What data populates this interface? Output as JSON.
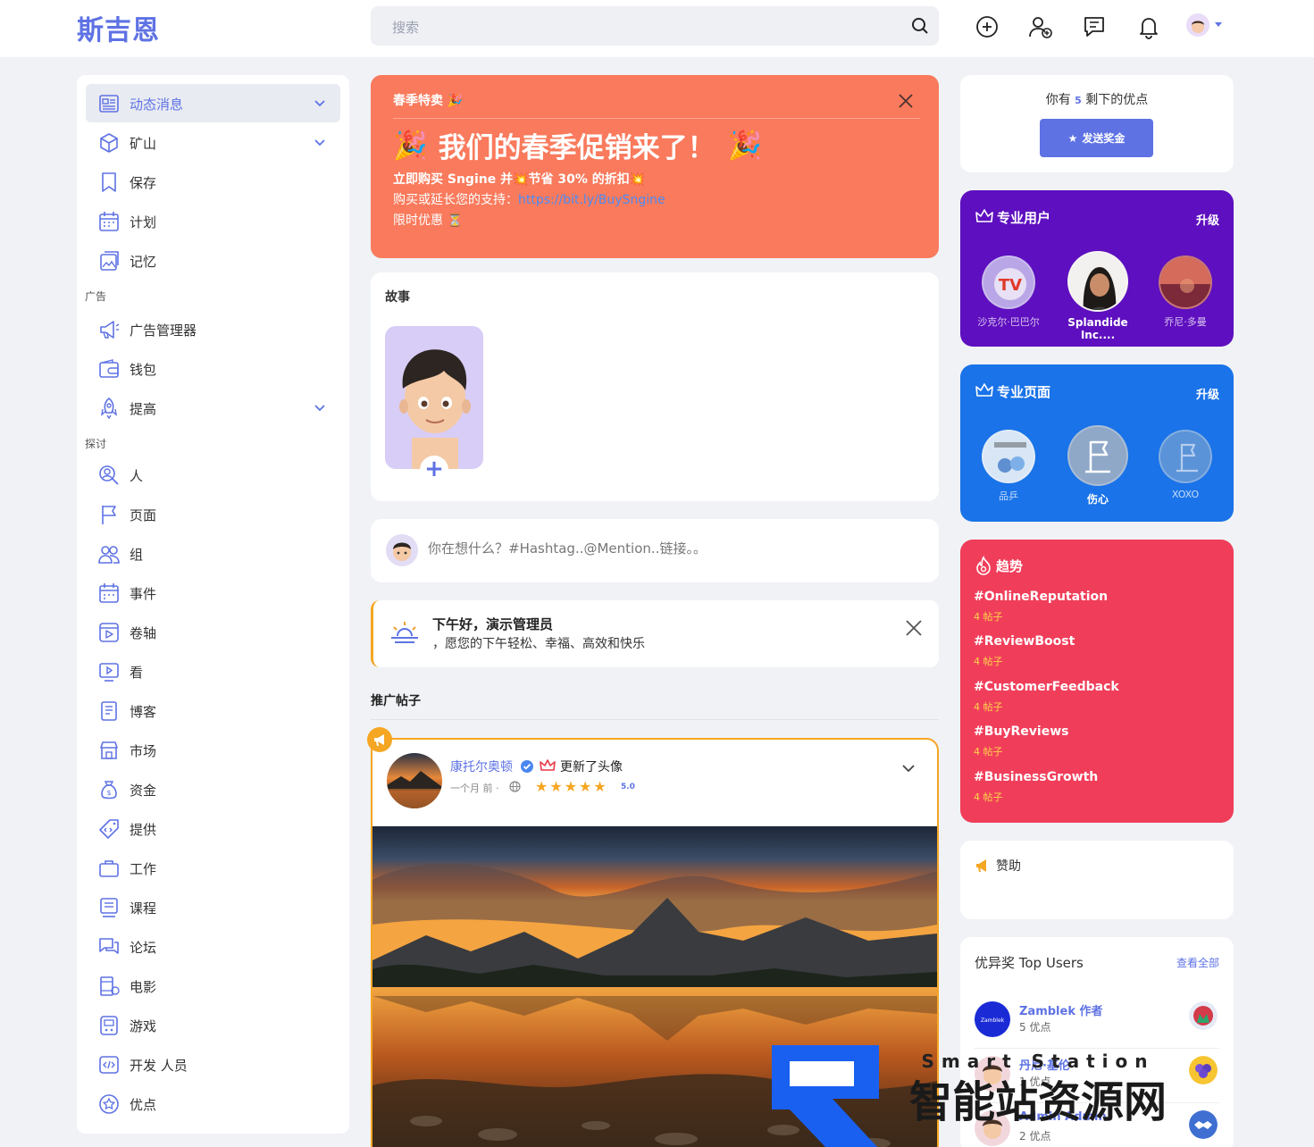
{
  "app": {
    "logo": "斯吉恩"
  },
  "search": {
    "placeholder": "搜索"
  },
  "sidebar": {
    "items": [
      {
        "label": "动态消息"
      },
      {
        "label": "矿山"
      },
      {
        "label": "保存"
      },
      {
        "label": "计划"
      },
      {
        "label": "记忆"
      },
      {
        "label": "广告管理器"
      },
      {
        "label": "钱包"
      },
      {
        "label": "提高"
      },
      {
        "label": "人"
      },
      {
        "label": "页面"
      },
      {
        "label": "组"
      },
      {
        "label": "事件"
      },
      {
        "label": "卷轴"
      },
      {
        "label": "看"
      },
      {
        "label": "博客"
      },
      {
        "label": "市场"
      },
      {
        "label": "资金"
      },
      {
        "label": "提供"
      },
      {
        "label": "工作"
      },
      {
        "label": "课程"
      },
      {
        "label": "论坛"
      },
      {
        "label": "电影"
      },
      {
        "label": "游戏"
      },
      {
        "label": "开发 人员"
      },
      {
        "label": "优点"
      }
    ],
    "sections": {
      "ads": "广告",
      "explore": "探讨"
    }
  },
  "promo": {
    "tag": "春季特卖",
    "headline": "我们的春季促销来了！",
    "line1_a": "立即购买 Sngine 并",
    "line1_b": "节省 30% 的折扣",
    "line2_label": "购买或延长您的支持：",
    "line2_link": "https://bit.ly/BuySngine",
    "line3": "限时优惠"
  },
  "stories": {
    "title": "故事",
    "add": "+"
  },
  "composer": {
    "placeholder": "你在想什么？#Hashtag..@Mention..链接。。"
  },
  "greeting": {
    "title": "下午好，演示管理员",
    "subtitle": "，愿您的下午轻松、幸福、高效和快乐"
  },
  "promoted": {
    "title": "推广帖子"
  },
  "post": {
    "author": "康托尔奥顿",
    "action": "更新了头像",
    "time": "一个月 前 ·",
    "stars": "★★★★★",
    "rating": "5.0"
  },
  "points": {
    "prefix": "你有",
    "value": "5",
    "suffix": "剩下的优点",
    "button": "发送奖金"
  },
  "pro_users": {
    "title": "专业用户",
    "upgrade": "升级",
    "users": [
      {
        "name": "沙克尔·巴巴尔"
      },
      {
        "name": "Splandide Inc...."
      },
      {
        "name": "乔尼·多曼"
      }
    ]
  },
  "pro_pages": {
    "title": "专业页面",
    "upgrade": "升级",
    "pages": [
      {
        "name": "品乒"
      },
      {
        "name": "伤心"
      },
      {
        "name": "XOXO"
      }
    ]
  },
  "trending": {
    "title": "趋势",
    "items": [
      {
        "tag": "#OnlineReputation",
        "count": "4 帖子"
      },
      {
        "tag": "#ReviewBoost",
        "count": "4 帖子"
      },
      {
        "tag": "#CustomerFeedback",
        "count": "4 帖子"
      },
      {
        "tag": "#BuyReviews",
        "count": "4 帖子"
      },
      {
        "tag": "#BusinessGrowth",
        "count": "4 帖子"
      }
    ]
  },
  "sponsored": {
    "title": "赞助"
  },
  "top_users": {
    "title": "优异奖 Top Users",
    "see_all": "查看全部",
    "users": [
      {
        "name": "Zamblek 作者",
        "points": "5 优点",
        "avatar_text": "Zamblek"
      },
      {
        "name": "丹尼·基伦",
        "points": "1 优点"
      },
      {
        "name": "Admin Admin",
        "points": "2 优点"
      }
    ]
  },
  "watermark": {
    "text": "智能站资源网",
    "sub": "Smart Station"
  },
  "colors": {
    "accent": "#5e72e4",
    "promo": "#f97a5c",
    "pro_users": "#5e0fbf",
    "pro_pages": "#1a73e8",
    "trending": "#f03e5a",
    "promoted_border": "#f5a623"
  }
}
